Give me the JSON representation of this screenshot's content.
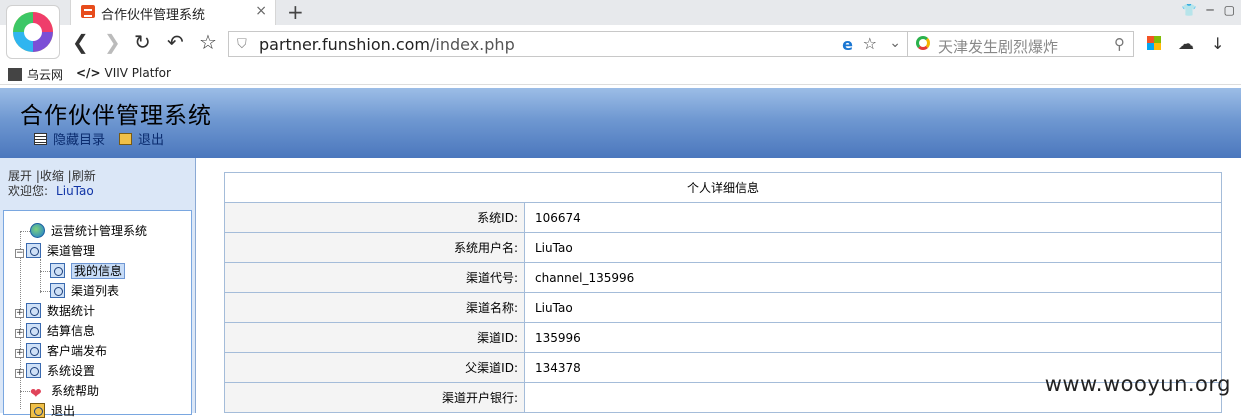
{
  "browser": {
    "tab_title": "合作伙伴管理系统",
    "tab_close": "×",
    "new_tab": "+",
    "url_host": "partner.funshion.com",
    "url_path": "/index.php",
    "search_placeholder": "天津发生剧烈爆炸",
    "bookmarks": [
      {
        "label": "乌云网"
      },
      {
        "label": "VIIV Platfor"
      }
    ]
  },
  "app": {
    "title": "合作伙伴管理系统",
    "header_links": [
      {
        "label": "隐藏目录",
        "icon": "list-icon"
      },
      {
        "label": "退出",
        "icon": "exit-icon"
      }
    ]
  },
  "sidebar": {
    "links": "展开 |收缩 |刷新",
    "welcome_label": "欢迎您:",
    "username": "LiuTao",
    "tree": [
      {
        "label": "运营统计管理系统",
        "icon": "globe-icon"
      },
      {
        "label": "渠道管理",
        "icon": "folder-icon"
      },
      {
        "label": "我的信息",
        "icon": "page-icon",
        "selected": true
      },
      {
        "label": "渠道列表",
        "icon": "page-icon"
      },
      {
        "label": "数据统计",
        "icon": "folder-icon"
      },
      {
        "label": "结算信息",
        "icon": "folder-icon"
      },
      {
        "label": "客户端发布",
        "icon": "folder-icon"
      },
      {
        "label": "系统设置",
        "icon": "folder-icon"
      },
      {
        "label": "系统帮助",
        "icon": "heart-icon"
      },
      {
        "label": "退出",
        "icon": "exit-icon"
      }
    ]
  },
  "detail": {
    "caption": "个人详细信息",
    "rows": [
      {
        "label": "系统ID:",
        "value": "106674"
      },
      {
        "label": "系统用户名:",
        "value": "LiuTao"
      },
      {
        "label": "渠道代号:",
        "value": "channel_135996"
      },
      {
        "label": "渠道名称:",
        "value": "LiuTao"
      },
      {
        "label": "渠道ID:",
        "value": "135996"
      },
      {
        "label": "父渠道ID:",
        "value": "134378"
      },
      {
        "label": "渠道开户银行:",
        "value": ""
      }
    ]
  },
  "watermark": "www.wooyun.org"
}
